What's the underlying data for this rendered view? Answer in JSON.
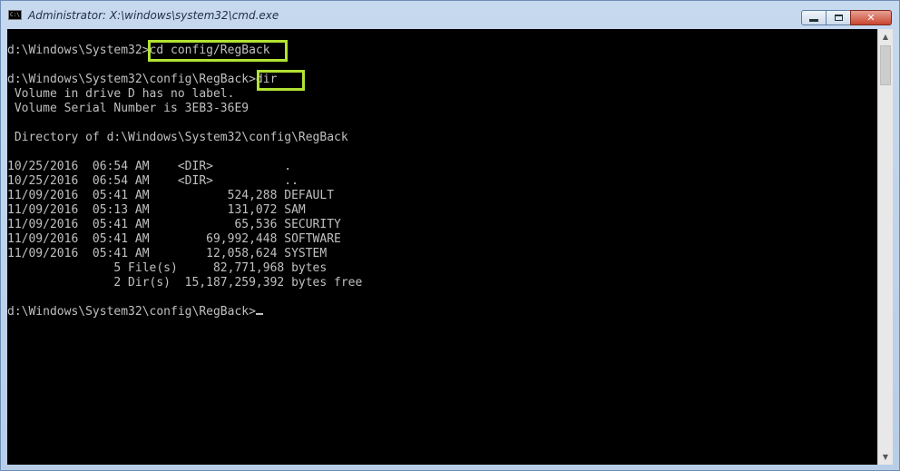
{
  "window": {
    "title": "Administrator: X:\\windows\\system32\\cmd.exe",
    "icon_text": "C:\\",
    "minimize_icon": "minimize-icon",
    "maximize_icon": "maximize-icon",
    "close_icon": "close-icon",
    "close_glyph": "✕"
  },
  "console": {
    "lines": [
      "d:\\Windows\\System32>cd config/RegBack",
      "",
      "d:\\Windows\\System32\\config\\RegBack>dir",
      " Volume in drive D has no label.",
      " Volume Serial Number is 3EB3-36E9",
      "",
      " Directory of d:\\Windows\\System32\\config\\RegBack",
      "",
      "10/25/2016  06:54 AM    <DIR>          .",
      "10/25/2016  06:54 AM    <DIR>          ..",
      "11/09/2016  05:41 AM           524,288 DEFAULT",
      "11/09/2016  05:13 AM           131,072 SAM",
      "11/09/2016  05:41 AM            65,536 SECURITY",
      "11/09/2016  05:41 AM        69,992,448 SOFTWARE",
      "11/09/2016  05:41 AM        12,058,624 SYSTEM",
      "               5 File(s)     82,771,968 bytes",
      "               2 Dir(s)  15,187,259,392 bytes free",
      "",
      "d:\\Windows\\System32\\config\\RegBack>"
    ],
    "highlight_color": "#b2e233",
    "text_color": "#c0c0c0",
    "background_color": "#000000"
  },
  "scrollbar": {
    "up_arrow": "▲",
    "down_arrow": "▼"
  }
}
